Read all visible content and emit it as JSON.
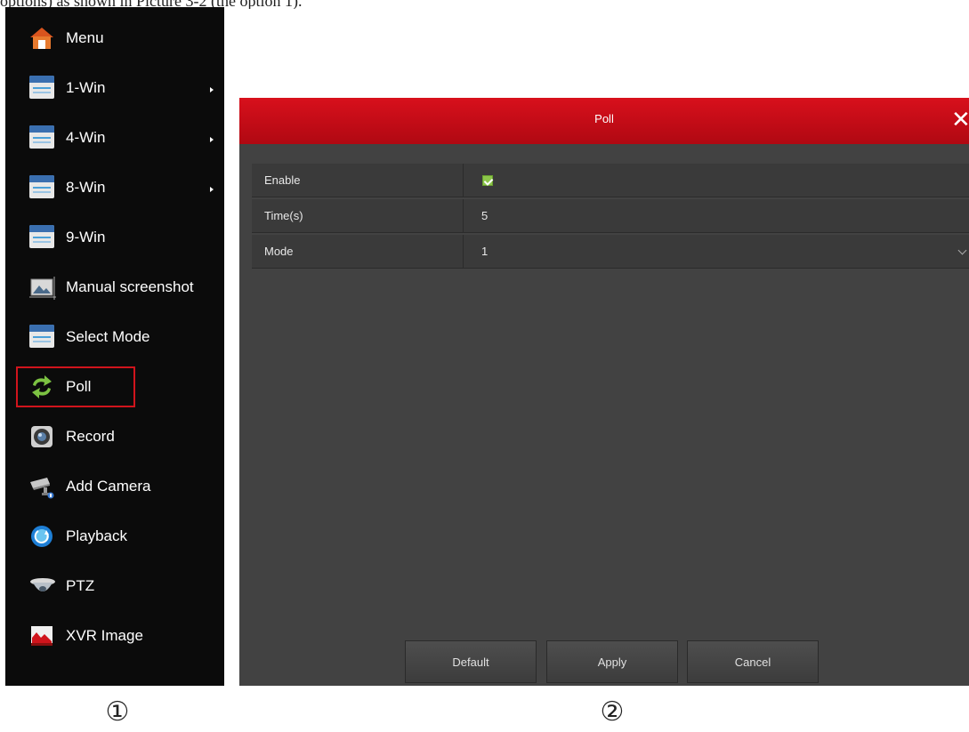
{
  "top_caption": "options) as shown in Picture 3-2 (the option 1).",
  "menu": {
    "items": [
      {
        "label": "Menu",
        "icon": "home-icon",
        "submenu": false
      },
      {
        "label": "1-Win",
        "icon": "window-icon",
        "submenu": true
      },
      {
        "label": "4-Win",
        "icon": "window-icon",
        "submenu": true
      },
      {
        "label": "8-Win",
        "icon": "window-icon",
        "submenu": true
      },
      {
        "label": "9-Win",
        "icon": "window-icon",
        "submenu": false
      },
      {
        "label": "Manual screenshot",
        "icon": "screenshot-icon",
        "submenu": false
      },
      {
        "label": "Select Mode",
        "icon": "window-icon",
        "submenu": false
      },
      {
        "label": "Poll",
        "icon": "refresh-icon",
        "submenu": false,
        "highlighted": true
      },
      {
        "label": "Record",
        "icon": "record-icon",
        "submenu": false
      },
      {
        "label": "Add Camera",
        "icon": "camera-icon",
        "submenu": false
      },
      {
        "label": "Playback",
        "icon": "playback-icon",
        "submenu": false
      },
      {
        "label": "PTZ",
        "icon": "ptz-icon",
        "submenu": false
      },
      {
        "label": "XVR Image",
        "icon": "image-icon",
        "submenu": false
      }
    ]
  },
  "panel": {
    "title": "Poll",
    "close_glyph": "✕",
    "rows": [
      {
        "label": "Enable",
        "type": "checkbox",
        "checked": true
      },
      {
        "label": "Time(s)",
        "type": "text",
        "value": "5"
      },
      {
        "label": "Mode",
        "type": "select",
        "value": "1"
      }
    ],
    "buttons": {
      "default": "Default",
      "apply": "Apply",
      "cancel": "Cancel"
    }
  },
  "captions": {
    "one": "①",
    "two": "②"
  },
  "colors": {
    "header_red": "#d8101c",
    "highlight_red": "#d0141c",
    "checkbox_green": "#8cc64a",
    "panel_bg": "#424242",
    "menu_bg": "#0b0b0b"
  }
}
